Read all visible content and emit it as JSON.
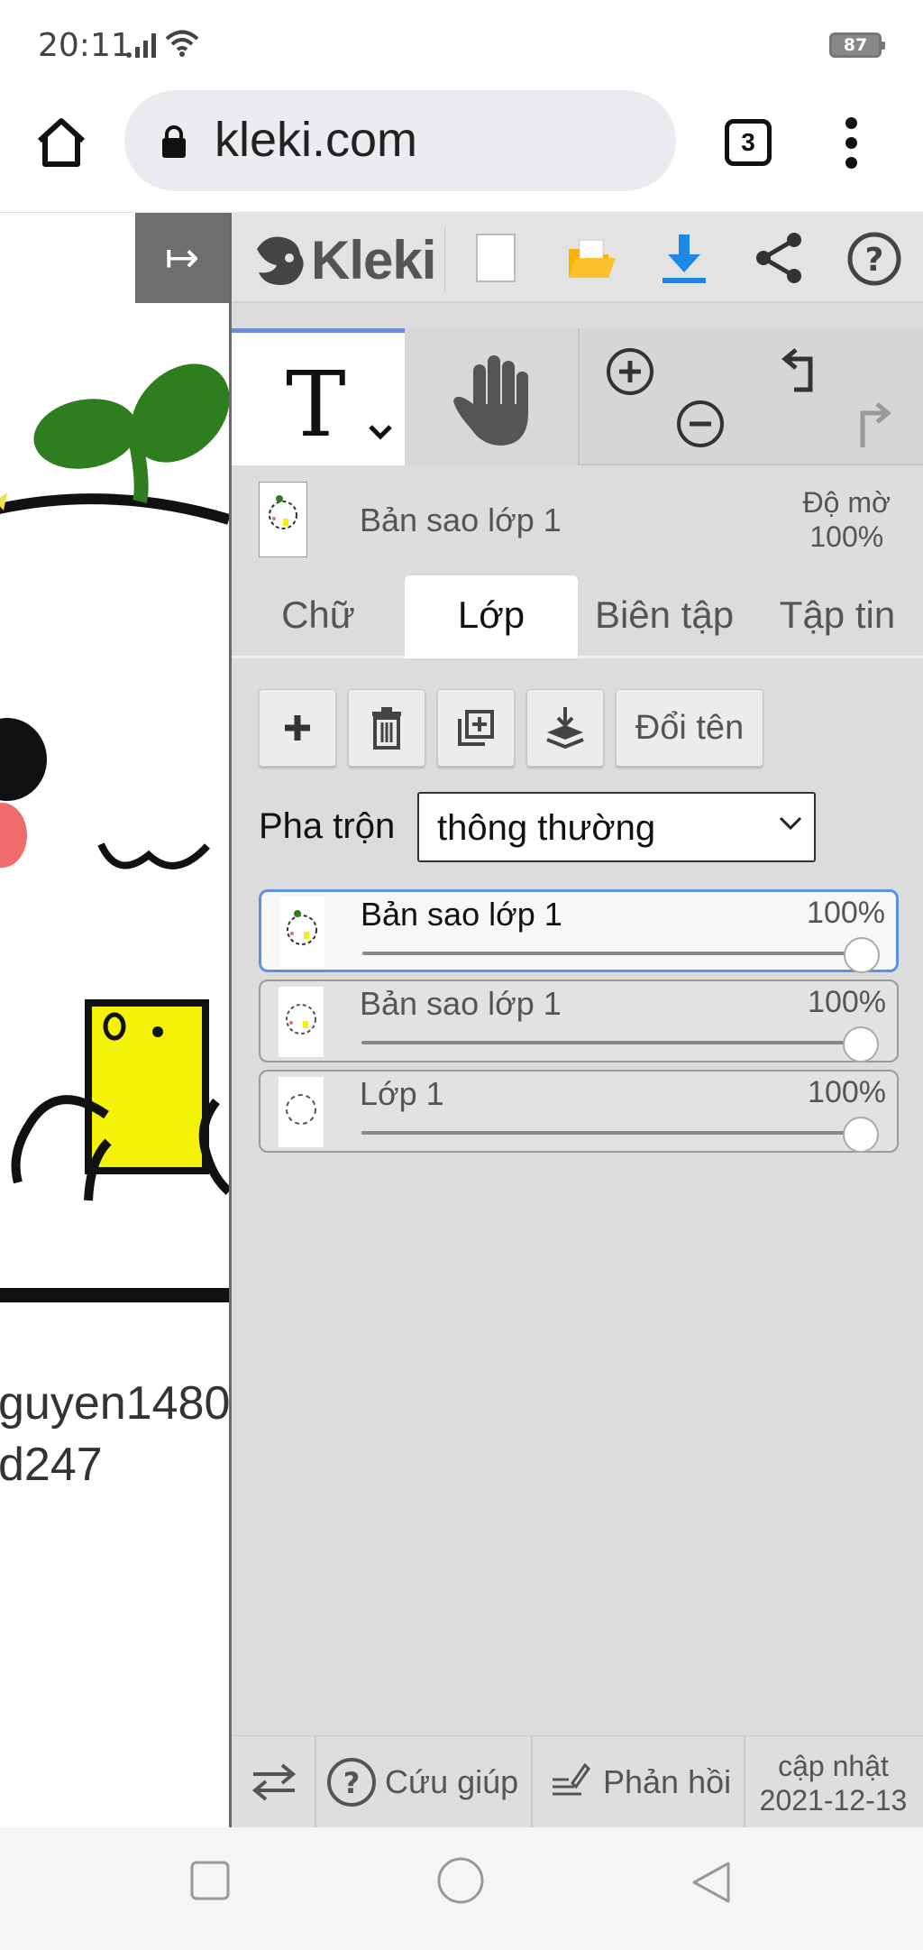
{
  "status_bar": {
    "time": "20:11",
    "battery": "87"
  },
  "browser": {
    "url": "kleki.com",
    "tab_count": "3"
  },
  "canvas": {
    "visible_text": [
      "guyen1480",
      "d247"
    ]
  },
  "kleki": {
    "logo_text": "Kleki",
    "toolbar_icons": [
      "new-image-icon",
      "open-folder-icon",
      "download-icon",
      "share-icon",
      "help-icon"
    ],
    "tools": {
      "active": "text",
      "items": [
        "text-tool",
        "hand-tool",
        "zoom-in",
        "zoom-out",
        "undo",
        "redo"
      ]
    },
    "current_layer": {
      "name": "Bản sao lớp 1",
      "opacity_label": "Độ mờ",
      "opacity_value": "100%"
    },
    "tabs": [
      {
        "label": "Chữ",
        "active": false
      },
      {
        "label": "Lớp",
        "active": true
      },
      {
        "label": "Biên tập",
        "active": false
      },
      {
        "label": "Tập tin",
        "active": false
      }
    ],
    "layer_actions": {
      "rename_label": "Đổi tên"
    },
    "blend": {
      "label": "Pha trộn",
      "selected": "thông thường"
    },
    "layers": [
      {
        "name": "Bản sao lớp 1",
        "opacity": "100%",
        "opacity_value": 1.0,
        "selected": true
      },
      {
        "name": "Bản sao lớp 1",
        "opacity": "100%",
        "opacity_value": 1.0,
        "selected": false
      },
      {
        "name": "Lớp 1",
        "opacity": "100%",
        "opacity_value": 1.0,
        "selected": false
      }
    ],
    "footer": {
      "help": "Cứu giúp",
      "feedback": "Phản hồi",
      "update_label": "cập nhật",
      "update_date": "2021-12-13"
    }
  },
  "colors": {
    "accent": "#6b8fd6",
    "download": "#1e88e5",
    "folder": "#f4b400",
    "panel_bg": "#dcdcdc"
  }
}
